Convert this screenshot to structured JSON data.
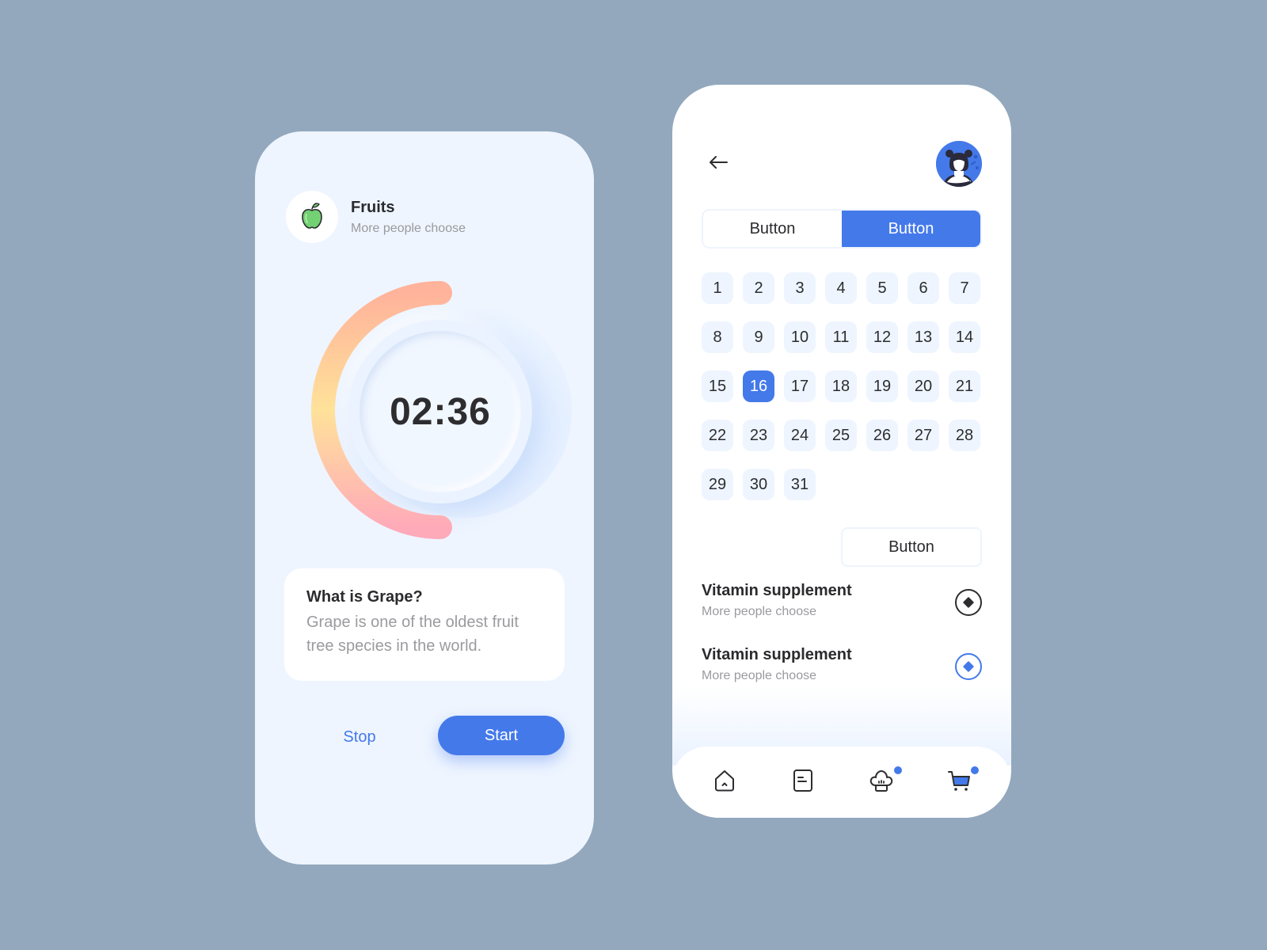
{
  "colors": {
    "background": "#93a8bd",
    "accent": "#4479ea",
    "card_bg": "#eef5ff",
    "text_primary": "#2b2b2e",
    "text_secondary": "#9a9a9e",
    "timer_gradient": [
      "#ffb39b",
      "#ffe29a",
      "#ffaab9"
    ]
  },
  "left_screen": {
    "header": {
      "icon": "apple-icon",
      "title": "Fruits",
      "subtitle": "More people choose"
    },
    "timer": {
      "value": "02:36",
      "progress_fraction": 0.5
    },
    "info_card": {
      "title": "What is Grape?",
      "body": "Grape is one of the oldest fruit tree species in the world."
    },
    "actions": {
      "stop_label": "Stop",
      "start_label": "Start"
    }
  },
  "right_screen": {
    "header": {
      "back_icon": "arrow-left-icon",
      "avatar": "user-avatar"
    },
    "segmented": [
      {
        "label": "Button",
        "active": false
      },
      {
        "label": "Button",
        "active": true
      }
    ],
    "calendar": {
      "days": [
        "1",
        "2",
        "3",
        "4",
        "5",
        "6",
        "7",
        "8",
        "9",
        "10",
        "11",
        "12",
        "13",
        "14",
        "15",
        "16",
        "17",
        "18",
        "19",
        "20",
        "21",
        "22",
        "23",
        "24",
        "25",
        "26",
        "27",
        "28",
        "29",
        "30",
        "31"
      ],
      "selected": "16"
    },
    "secondary_button_label": "Button",
    "options": [
      {
        "title": "Vitamin supplement",
        "subtitle": "More people choose",
        "radio_color": "dark"
      },
      {
        "title": "Vitamin supplement",
        "subtitle": "More people choose",
        "radio_color": "blue"
      }
    ],
    "bottom_nav": [
      {
        "icon": "home-icon",
        "badge": false
      },
      {
        "icon": "document-icon",
        "badge": false
      },
      {
        "icon": "chef-hat-icon",
        "badge": true
      },
      {
        "icon": "cart-icon",
        "badge": true
      }
    ]
  }
}
